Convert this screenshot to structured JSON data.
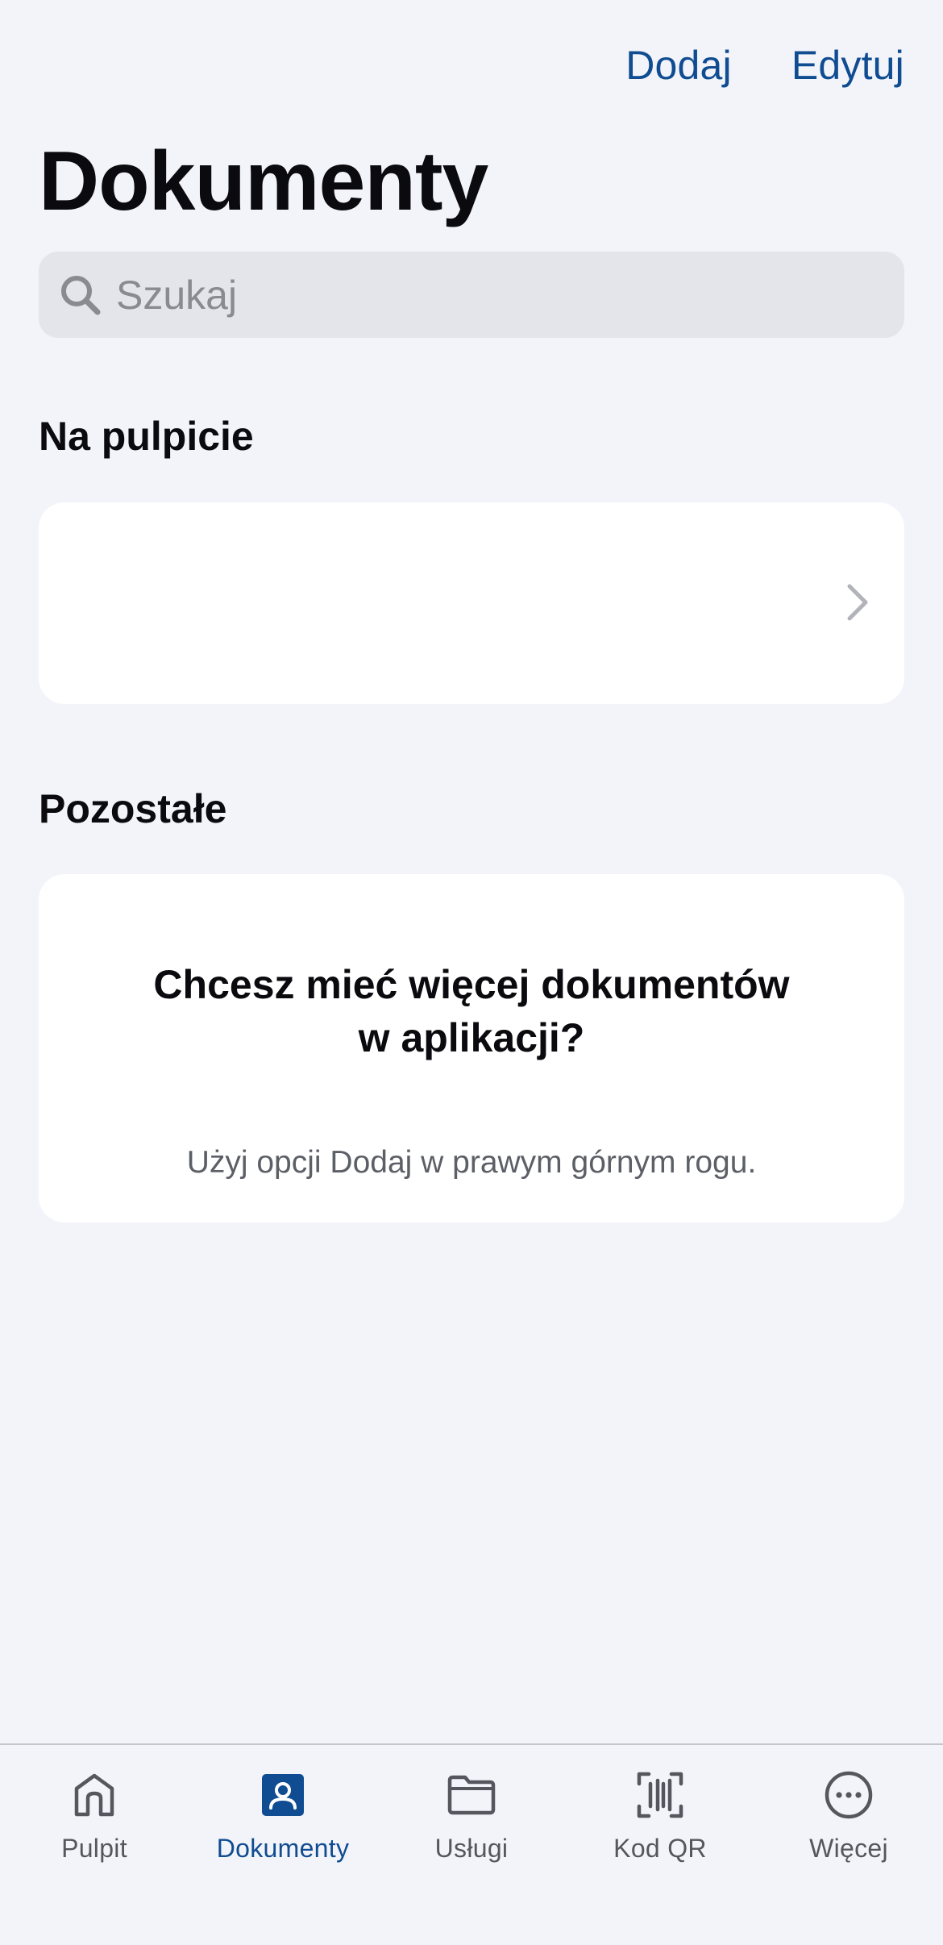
{
  "header": {
    "add_label": "Dodaj",
    "edit_label": "Edytuj",
    "title": "Dokumenty"
  },
  "search": {
    "placeholder": "Szukaj",
    "value": ""
  },
  "sections": {
    "desktop": {
      "title": "Na pulpicie"
    },
    "others": {
      "title": "Pozostałe",
      "empty_title": "Chcesz mieć więcej dokumentów w aplikacji?",
      "empty_desc": "Użyj opcji Dodaj w prawym górnym rogu."
    }
  },
  "tabbar": {
    "active_color": "#0f4c91",
    "items": [
      {
        "label": "Pulpit",
        "icon": "home-icon"
      },
      {
        "label": "Dokumenty",
        "icon": "document-person-icon",
        "active": true
      },
      {
        "label": "Usługi",
        "icon": "folder-icon"
      },
      {
        "label": "Kod QR",
        "icon": "qr-scan-icon"
      },
      {
        "label": "Więcej",
        "icon": "more-icon"
      }
    ]
  },
  "colors": {
    "accent": "#0f4c91",
    "background": "#f3f4f9",
    "card": "#ffffff",
    "search_bg": "#e4e5ea"
  }
}
